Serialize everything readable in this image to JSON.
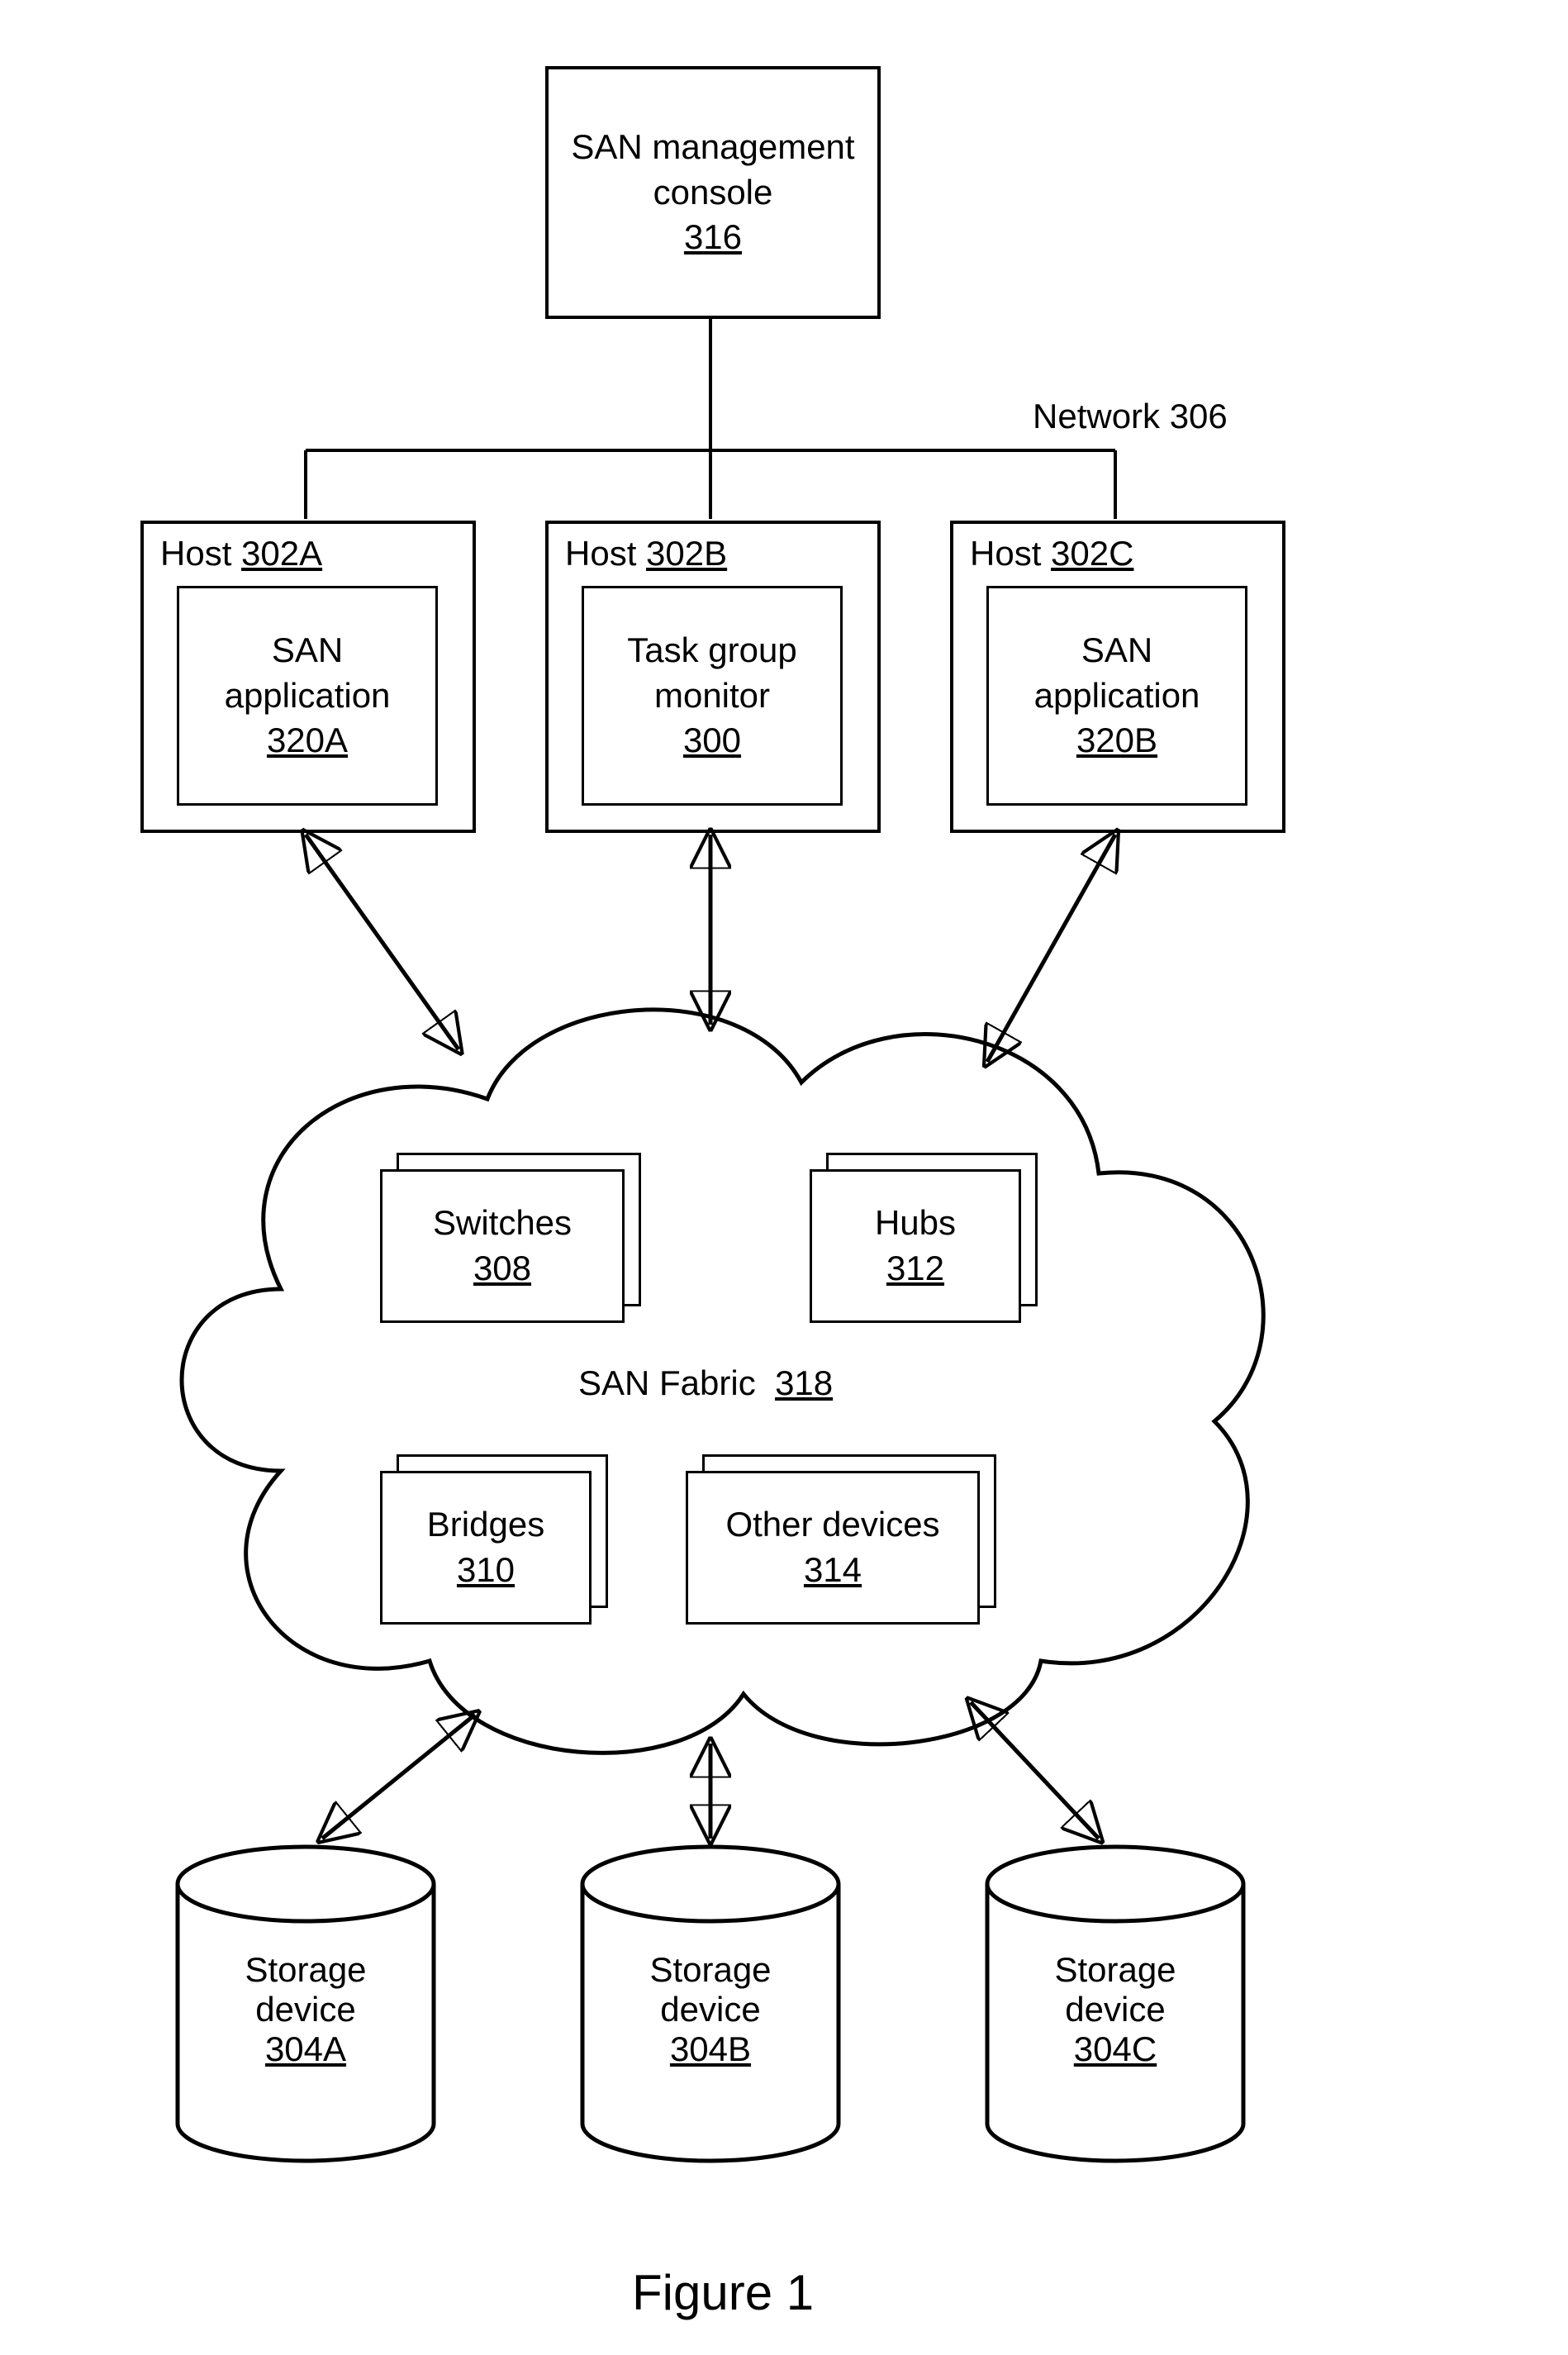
{
  "console": {
    "title_line1": "SAN management",
    "title_line2": "console",
    "ref": "316"
  },
  "network_label": "Network  306",
  "hosts": [
    {
      "host_prefix": "Host",
      "host_ref": "302A",
      "inner_line1": "SAN",
      "inner_line2": "application",
      "inner_ref": "320A"
    },
    {
      "host_prefix": "Host",
      "host_ref": "302B",
      "inner_line1": "Task group",
      "inner_line2": "monitor",
      "inner_ref": "300"
    },
    {
      "host_prefix": "Host",
      "host_ref": "302C",
      "inner_line1": "SAN",
      "inner_line2": "application",
      "inner_ref": "320B"
    }
  ],
  "fabric": {
    "label": "SAN Fabric",
    "ref": "318",
    "switches": {
      "label": "Switches",
      "ref": "308"
    },
    "hubs": {
      "label": "Hubs",
      "ref": "312"
    },
    "bridges": {
      "label": "Bridges",
      "ref": "310"
    },
    "other": {
      "label": "Other devices",
      "ref": "314"
    }
  },
  "storage": [
    {
      "line1": "Storage",
      "line2": "device",
      "ref": "304A"
    },
    {
      "line1": "Storage",
      "line2": "device",
      "ref": "304B"
    },
    {
      "line1": "Storage",
      "line2": "device",
      "ref": "304C"
    }
  ],
  "figure_label": "Figure 1"
}
